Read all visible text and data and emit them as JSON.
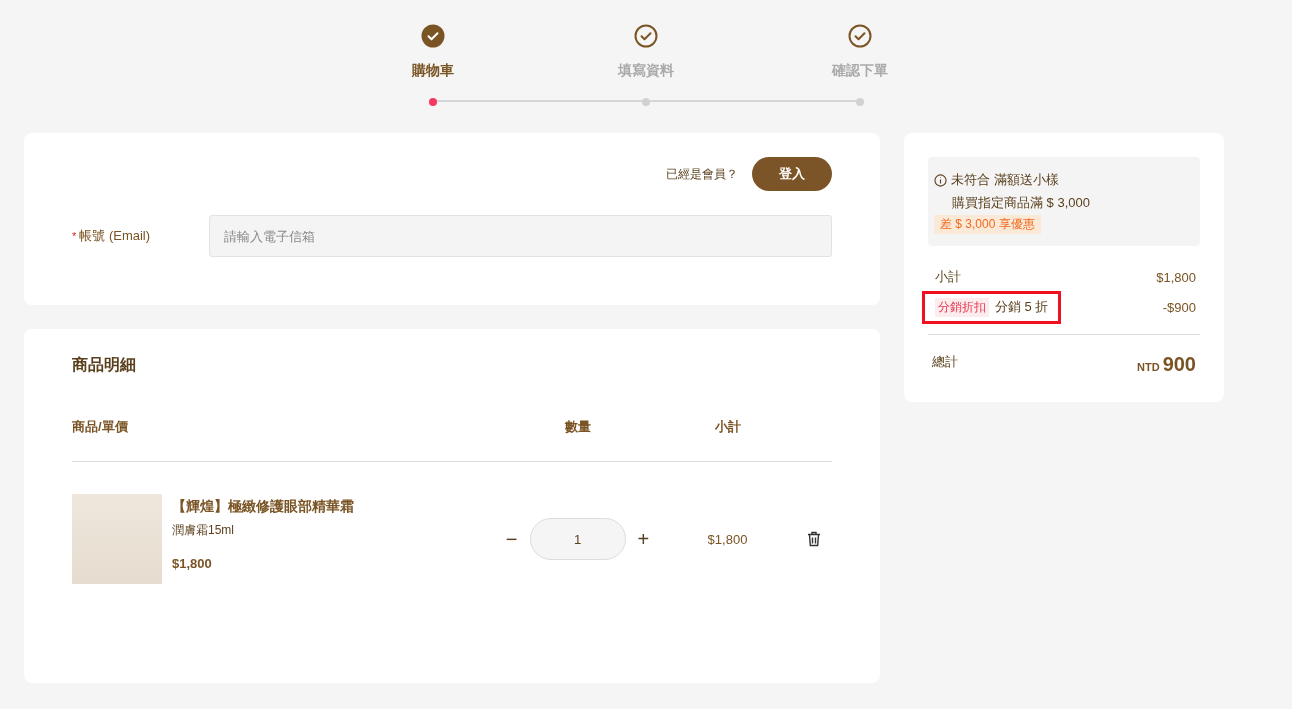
{
  "steps": [
    {
      "label": "購物車",
      "selected": true
    },
    {
      "label": "填寫資料",
      "selected": false
    },
    {
      "label": "確認下單",
      "selected": false
    }
  ],
  "login": {
    "prompt": "已經是會員？",
    "button": "登入",
    "email_label": "帳號 (Email)",
    "required_mark": "*",
    "email_placeholder": "請輸入電子信箱"
  },
  "products": {
    "title": "商品明細",
    "columns": [
      "商品/單價",
      "數量",
      "小計"
    ],
    "rows": [
      {
        "name": "【輝煌】極緻修護眼部精華霜",
        "variant": "潤膚霜15ml",
        "price": "$1,800",
        "quantity": "1",
        "minus": "−",
        "plus": "+",
        "subtotal": "$1,800"
      }
    ]
  },
  "summary": {
    "notice": {
      "title": "未符合 滿額送小樣",
      "detail": "購買指定商品滿 $ 3,000",
      "badge": "差 $ 3,000 享優惠"
    },
    "lines": [
      {
        "kind": "plain",
        "label": "小計",
        "value": "$1,800",
        "highlighted": false
      },
      {
        "kind": "discount",
        "tag": "分銷折扣",
        "label": "分銷 5 折",
        "value": "-$900",
        "highlighted": true
      }
    ],
    "total": {
      "label": "總計",
      "currency": "NTD",
      "amount": "900"
    }
  }
}
